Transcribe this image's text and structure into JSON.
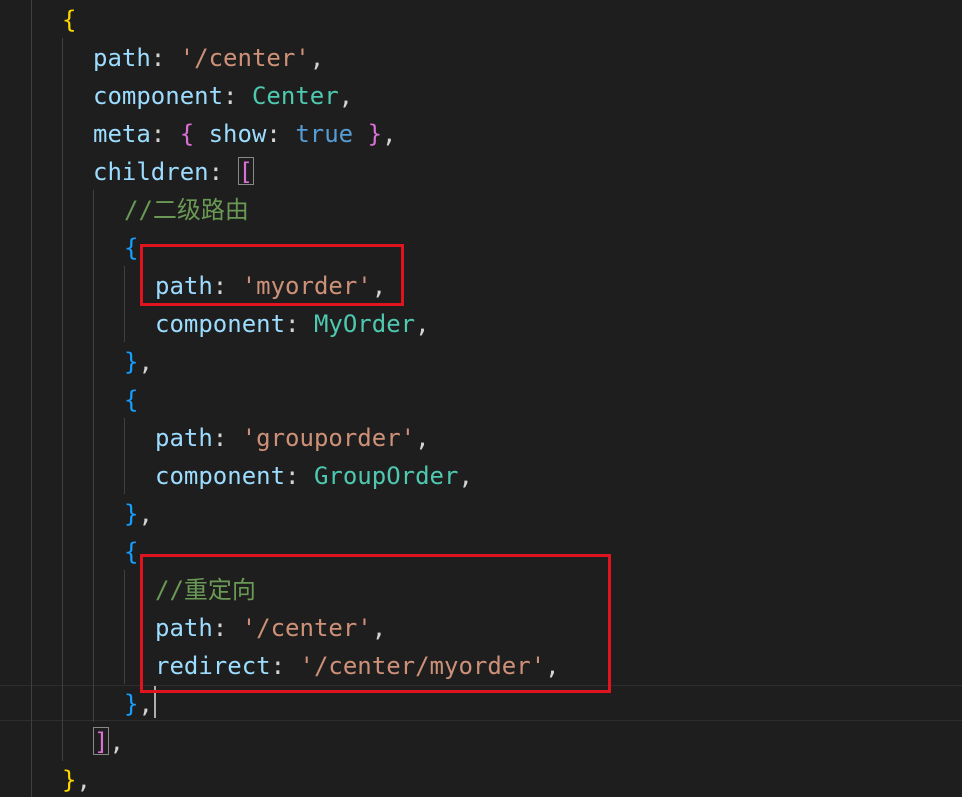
{
  "editor": {
    "theme": "dark",
    "colors": {
      "background": "#1e1e1e",
      "property": "#9cdcfe",
      "string": "#ce9178",
      "class_name": "#4ec9b0",
      "keyword": "#569cd6",
      "comment": "#6a9955",
      "bracket_level1": "#ffd700",
      "bracket_level2": "#da70d6",
      "bracket_level3": "#179fff",
      "highlight_box": "#e0141e"
    },
    "code": {
      "open_outer": "{",
      "path_key": "path",
      "path_value": "'/center'",
      "component_key": "component",
      "component_value": "Center",
      "meta_key": "meta",
      "meta_open": "{",
      "show_key": "show",
      "show_value": "true",
      "meta_close": "}",
      "children_key": "children",
      "children_open": "[",
      "comment_nested": "//二级路由",
      "child1_open": "{",
      "child1_path_key": "path",
      "child1_path_value": "'myorder'",
      "child1_component_key": "component",
      "child1_component_value": "MyOrder",
      "child1_close": "}",
      "child2_open": "{",
      "child2_path_key": "path",
      "child2_path_value": "'grouporder'",
      "child2_component_key": "component",
      "child2_component_value": "GroupOrder",
      "child2_close": "}",
      "child3_open": "{",
      "comment_redirect": "//重定向",
      "child3_path_key": "path",
      "child3_path_value": "'/center'",
      "child3_redirect_key": "redirect",
      "child3_redirect_value": "'/center/myorder'",
      "child3_close": "}",
      "children_close": "]",
      "close_outer": "}"
    }
  }
}
